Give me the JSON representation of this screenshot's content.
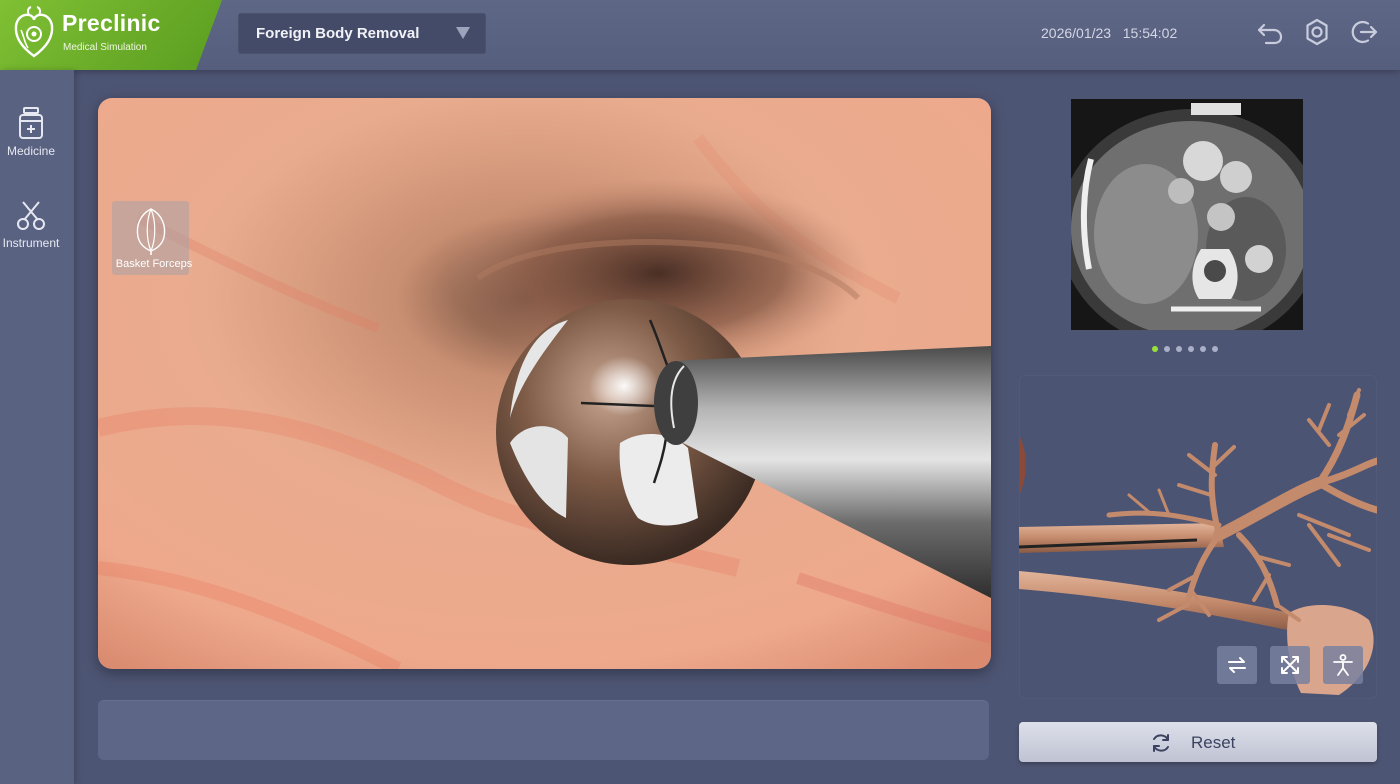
{
  "brand": {
    "name": "Preclinic",
    "subtitle": "Medical Simulation"
  },
  "header": {
    "scenario": "Foreign Body Removal",
    "date": "2026/01/23",
    "time": "15:54:02",
    "icons": [
      "undo-icon",
      "settings-icon",
      "exit-icon"
    ]
  },
  "sidebar": {
    "items": [
      {
        "label": "Medicine",
        "icon": "medicine-icon"
      },
      {
        "label": "Instrument",
        "icon": "scissors-icon"
      }
    ]
  },
  "viewport": {
    "active_tool": "Basket Forceps"
  },
  "ct": {
    "pages": 6,
    "active_page": 1
  },
  "model_controls": [
    "swap-view-icon",
    "expand-icon",
    "body-icon"
  ],
  "reset": {
    "label": "Reset"
  },
  "colors": {
    "brand_green": "#6fb22c",
    "active_dot": "#9be03a",
    "panel": "#4d5574"
  }
}
